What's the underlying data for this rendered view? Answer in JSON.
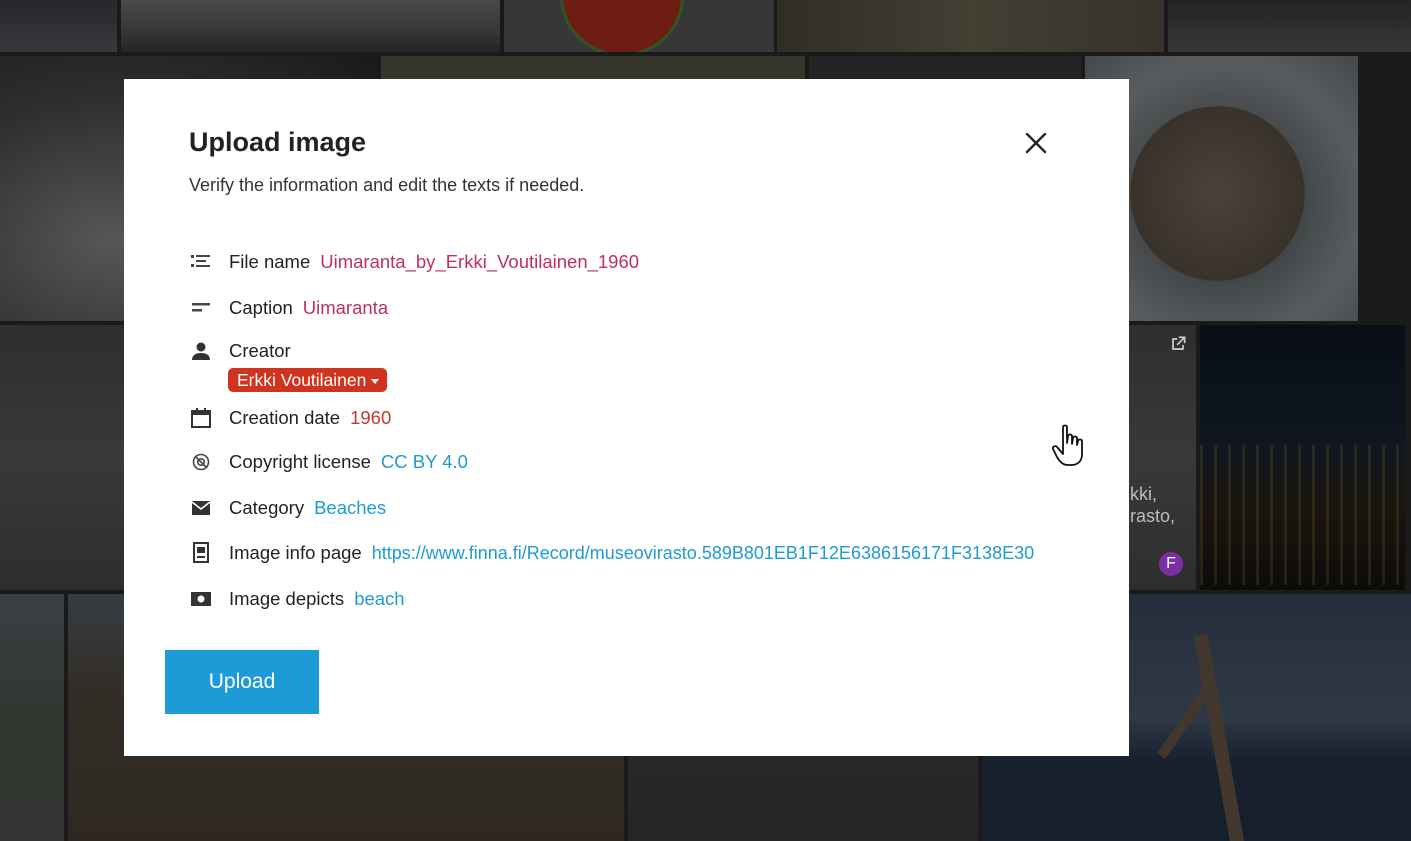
{
  "background": {
    "overlay_caption": "kki,\nrasto,",
    "avatar_letter": "F",
    "external_link_icon": "external-link-icon"
  },
  "modal": {
    "title": "Upload image",
    "subtitle": "Verify the information and edit the texts if needed.",
    "close_icon": "close-icon",
    "fields": {
      "file_name": {
        "label": "File name",
        "value": "Uimaranta_by_Erkki_Voutilainen_1960",
        "icon": "list-icon"
      },
      "caption": {
        "label": "Caption",
        "value": "Uimaranta",
        "icon": "short-text-icon"
      },
      "creator": {
        "label": "Creator",
        "value": "Erkki Voutilainen",
        "icon": "person-icon"
      },
      "creation_date": {
        "label": "Creation date",
        "value": "1960",
        "icon": "calendar-icon"
      },
      "copyright_license": {
        "label": "Copyright license",
        "value": "CC BY 4.0",
        "icon": "copyright-icon"
      },
      "category": {
        "label": "Category",
        "value": "Beaches",
        "icon": "envelope-icon"
      },
      "image_info_page": {
        "label": "Image info page",
        "value": "https://www.finna.fi/Record/museovirasto.589B801EB1F12E6386156171F3138E30",
        "icon": "document-icon"
      },
      "image_depicts": {
        "label": "Image depicts",
        "value": "beach",
        "icon": "photo-icon"
      }
    },
    "upload_label": "Upload"
  },
  "colors": {
    "accent": "#1e9bd7",
    "chip": "#d0341e",
    "value_red": "#c0392b",
    "value_link": "#1e9bd0"
  }
}
